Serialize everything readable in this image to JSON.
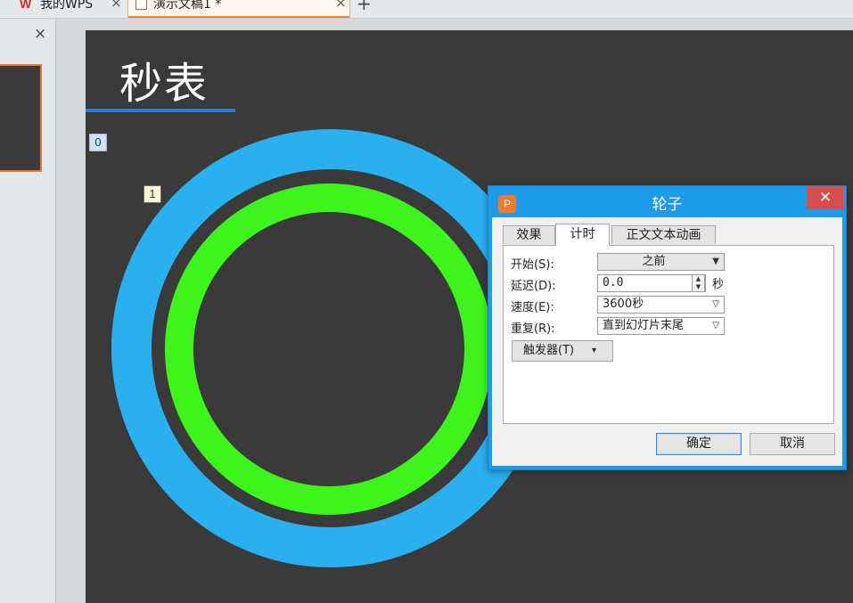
{
  "tabs": {
    "wps_home": {
      "logo": "W",
      "label": "我的WPS",
      "close": "×"
    },
    "document": {
      "label": "演示文稿1 *",
      "close": "×"
    },
    "new_tab": "+"
  },
  "thumbnail_panel": {
    "close": "×"
  },
  "slide": {
    "title": "秒表",
    "animation_tags": [
      "0",
      "1"
    ],
    "colors": {
      "background": "#3a3a3b",
      "outer_ring": "#2bb0ef",
      "inner_ring": "#3ef41c",
      "title_underline": "#2b7bd6"
    }
  },
  "dialog": {
    "title": "轮子",
    "app_icon": "P",
    "close": "✕",
    "tabs": [
      "效果",
      "计时",
      "正文文本动画"
    ],
    "active_tab": "计时",
    "fields": {
      "start": {
        "label": "开始(S):",
        "value": "之前"
      },
      "delay": {
        "label": "延迟(D):",
        "value": "0.0",
        "unit": "秒"
      },
      "speed": {
        "label": "速度(E):",
        "value": "3600秒"
      },
      "repeat": {
        "label": "重复(R):",
        "value": "直到幻灯片末尾"
      }
    },
    "trigger_label": "触发器(T)",
    "ok_label": "确定",
    "cancel_label": "取消",
    "colors": {
      "title_bar": "#1e9be8",
      "close_button": "#d64e4e"
    }
  }
}
